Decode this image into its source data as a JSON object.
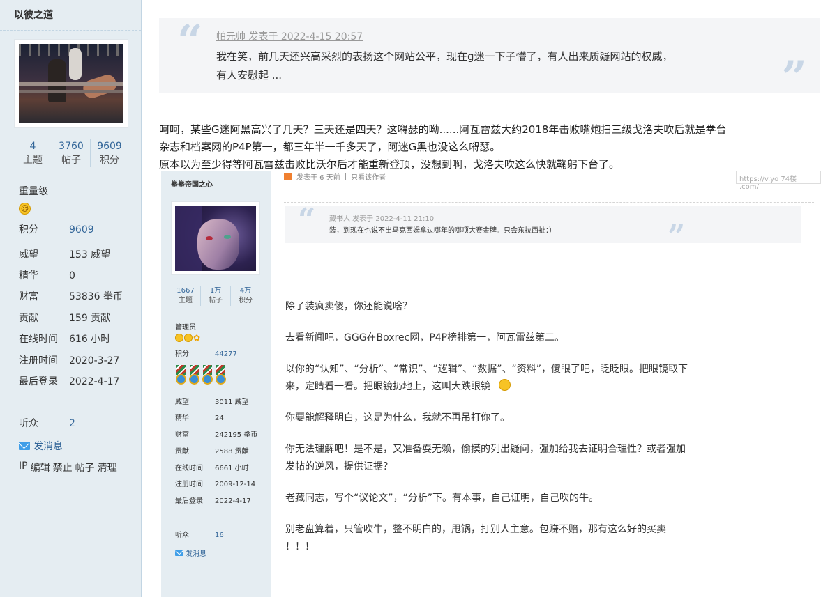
{
  "sidebar": {
    "username": "以彼之道",
    "stats": [
      {
        "num": "4",
        "label": "主题"
      },
      {
        "num": "3760",
        "label": "帖子"
      },
      {
        "num": "9609",
        "label": "积分"
      }
    ],
    "rank": "重量级",
    "rows": [
      {
        "k": "积分",
        "v": "9609",
        "link": true
      },
      {
        "k": "威望",
        "v": "153 威望"
      },
      {
        "k": "精华",
        "v": "0"
      },
      {
        "k": "财富",
        "v": "53836 拳币"
      },
      {
        "k": "贡献",
        "v": "159 贡献"
      },
      {
        "k": "在线时间",
        "v": "616 小时"
      },
      {
        "k": "注册时间",
        "v": "2020-3-27"
      },
      {
        "k": "最后登录",
        "v": "2022-4-17"
      }
    ],
    "listeners": {
      "k": "听众",
      "v": "2"
    },
    "send_message": "发消息",
    "admin_links": [
      "IP",
      "编辑",
      "禁止",
      "帖子",
      "清理"
    ]
  },
  "quote": {
    "meta": "帕元帅 发表于 2022-4-15 20:57",
    "line1": "我在笑，前几天还兴高采烈的表扬这个网站公平，现在g迷一下子懵了，有人出来质疑网站的权威，",
    "line2": "有人安慰起 ..."
  },
  "reply": {
    "line1": "呵呵，某些G迷阿黑高兴了几天？三天还是四天？这嘚瑟的呦......阿瓦雷兹大约2018年击败嘴炮扫三级戈洛夫吹后就是拳台",
    "line2": "杂志和档案网的P4P第一，都三年半一千多天了，阿迷G黑也没这么嘚瑟。",
    "line3": "原本以为至少得等阿瓦雷兹击败比沃尔后才能重新登顶，没想到啊，戈洛夫吹这么快就鞠躬下台了。"
  },
  "embedded": {
    "username": "拳拳帝国之心",
    "stats": [
      {
        "num": "1667",
        "label": "主题"
      },
      {
        "num": "1万",
        "label": "帖子"
      },
      {
        "num": "4万",
        "label": "积分"
      }
    ],
    "rank": "管理员",
    "score_row": {
      "k": "积分",
      "v": "44277"
    },
    "rows": [
      {
        "k": "威望",
        "v": "3011 威望"
      },
      {
        "k": "精华",
        "v": "24"
      },
      {
        "k": "财富",
        "v": "242195 拳币"
      },
      {
        "k": "贡献",
        "v": "2588 贡献"
      },
      {
        "k": "在线时间",
        "v": "6661 小时"
      },
      {
        "k": "注册时间",
        "v": "2009-12-14"
      },
      {
        "k": "最后登录",
        "v": "2022-4-17"
      }
    ],
    "listeners": {
      "k": "听众",
      "v": "16"
    },
    "send_message": "发消息",
    "top_meta": "发表于 6 天前",
    "top_author_only": "只看该作者",
    "watermark": "https://v.yo 74楼 .com/",
    "quote_meta": "藏书人 发表于 2022-4-11 21:10",
    "quote_text": "装，到现在也说不出马克西姆拿过哪年的哪项大赛金牌。只会东拉西扯：）",
    "body": {
      "p1": "除了装疯卖傻，你还能说啥？",
      "p2": "去看新闻吧，GGG在Boxrec网，P4P榜排第一，阿瓦雷兹第二。",
      "p3a": "以你的“认知”、“分析”、“常识”、“逻辑”、“数据”、“资料”，傻眼了吧，眨眨眼。把眼镜取下",
      "p3b": "来，定睛看一看。把眼镜扔地上，这叫大跌眼镜",
      "p4": "你要能解释明白，这是为什么，我就不再吊打你了。",
      "p5a": "你无法理解吧！是不是，又准备耍无赖，偷摸的列出疑问，强加给我去证明合理性？或者强加",
      "p5b": "发帖的逆风，提供证据？",
      "p6": "老藏同志，写个“议论文”，“分析”下。有本事，自己证明，自己吹的牛。",
      "p7a": "别老盘算着，只管吹牛，整不明白的，甩锅，打别人主意。包赚不赔，那有这么好的买卖",
      "p7b": "！！！"
    }
  },
  "colors": {
    "sidebar_bg": "#e5edf2",
    "link": "#336699",
    "quote_bg": "#f4f5f7"
  }
}
